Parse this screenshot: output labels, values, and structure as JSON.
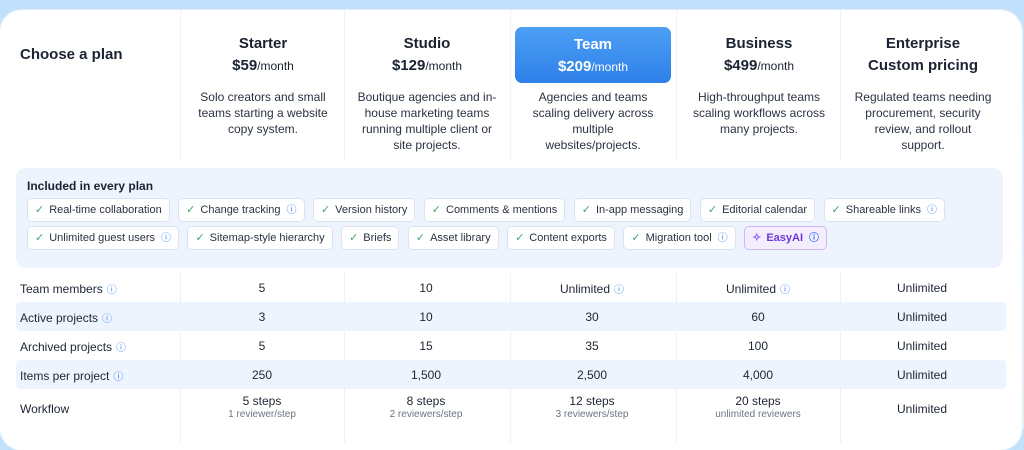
{
  "header": {
    "choose_label": "Choose a plan"
  },
  "plans": [
    {
      "name": "Starter",
      "price": "$59",
      "per": "/month",
      "desc": "Solo creators and small teams starting a website copy system."
    },
    {
      "name": "Studio",
      "price": "$129",
      "per": "/month",
      "desc": "Boutique agencies and in-house marketing teams running multiple client or site projects."
    },
    {
      "name": "Team",
      "price": "$209",
      "per": "/month",
      "desc": "Agencies and teams scaling delivery across multiple websites/projects."
    },
    {
      "name": "Business",
      "price": "$499",
      "per": "/month",
      "desc": "High-throughput teams scaling workflows across many projects."
    },
    {
      "name": "Enterprise",
      "price": "Custom pricing",
      "per": "",
      "desc": "Regulated teams needing procurement, security review, and rollout support."
    }
  ],
  "included": {
    "title": "Included in every plan",
    "row1": [
      "Real-time collaboration",
      "Change tracking",
      "Version history",
      "Comments & mentions",
      "In-app messaging",
      "Editorial calendar",
      "Shareable links"
    ],
    "row2": [
      "Unlimited guest users",
      "Sitemap-style hierarchy",
      "Briefs",
      "Asset library",
      "Content exports",
      "Migration tool"
    ],
    "ai_chip": "EasyAI"
  },
  "table": {
    "rows": [
      {
        "label": "Team members",
        "values": [
          "5",
          "10",
          "Unlimited",
          "Unlimited",
          "Unlimited"
        ]
      },
      {
        "label": "Active projects",
        "values": [
          "3",
          "10",
          "30",
          "60",
          "Unlimited"
        ]
      },
      {
        "label": "Archived projects",
        "values": [
          "5",
          "15",
          "35",
          "100",
          "Unlimited"
        ]
      },
      {
        "label": "Items per project",
        "values": [
          "250",
          "1,500",
          "2,500",
          "4,000",
          "Unlimited"
        ]
      }
    ],
    "workflow": {
      "label": "Workflow",
      "values": [
        {
          "main": "5 steps",
          "sub": "1 reviewer/step"
        },
        {
          "main": "8 steps",
          "sub": "2 reviewers/step"
        },
        {
          "main": "12 steps",
          "sub": "3 reviewers/step"
        },
        {
          "main": "20 steps",
          "sub": "unlimited reviewers"
        },
        {
          "main": "Unlimited",
          "sub": ""
        }
      ]
    }
  },
  "colors": {
    "accent": "#2e7fe8",
    "check": "#3aa76d",
    "info": "#3b82f6",
    "ai": "#6b3ad6"
  },
  "icons": {
    "check": "check-icon",
    "info": "info-icon",
    "ai": "sparkle-icon"
  }
}
